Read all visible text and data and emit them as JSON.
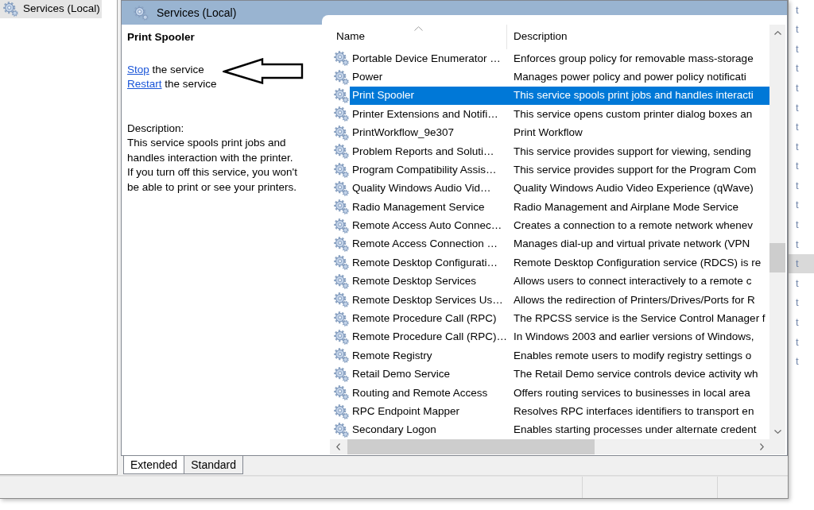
{
  "tree": {
    "items": [
      {
        "label": "Services (Local)",
        "selected": true
      }
    ]
  },
  "header": {
    "title": "Services (Local)"
  },
  "details": {
    "title": "Print Spooler",
    "actions": [
      {
        "link": "Stop",
        "text": "the service"
      },
      {
        "link": "Restart",
        "text": "the service"
      }
    ],
    "description_label": "Description:",
    "description_lines": [
      "This service spools print jobs and",
      "handles interaction with the printer.",
      "If you turn off this service, you won't",
      "be able to print or see your printers."
    ]
  },
  "table": {
    "columns": [
      {
        "label": "Name",
        "sorted": true
      },
      {
        "label": "Description",
        "sorted": false
      }
    ],
    "rows": [
      {
        "name": "Portable Device Enumerator …",
        "description": "Enforces group policy for removable mass-storage",
        "selected": false
      },
      {
        "name": "Power",
        "description": "Manages power policy and power policy notificati",
        "selected": false
      },
      {
        "name": "Print Spooler",
        "description": "This service spools print jobs and handles interacti",
        "selected": true
      },
      {
        "name": "Printer Extensions and Notifi…",
        "description": "This service opens custom printer dialog boxes an",
        "selected": false
      },
      {
        "name": "PrintWorkflow_9e307",
        "description": "Print Workflow",
        "selected": false
      },
      {
        "name": "Problem Reports and Soluti…",
        "description": "This service provides support for viewing, sending",
        "selected": false
      },
      {
        "name": "Program Compatibility Assis…",
        "description": "This service provides support for the Program Com",
        "selected": false
      },
      {
        "name": "Quality Windows Audio Vid…",
        "description": "Quality Windows Audio Video Experience (qWave)",
        "selected": false
      },
      {
        "name": "Radio Management Service",
        "description": "Radio Management and Airplane Mode Service",
        "selected": false
      },
      {
        "name": "Remote Access Auto Connec…",
        "description": "Creates a connection to a remote network whenev",
        "selected": false
      },
      {
        "name": "Remote Access Connection …",
        "description": "Manages dial-up and virtual private network (VPN",
        "selected": false
      },
      {
        "name": "Remote Desktop Configurati…",
        "description": "Remote Desktop Configuration service (RDCS) is re",
        "selected": false
      },
      {
        "name": "Remote Desktop Services",
        "description": "Allows users to connect interactively to a remote c",
        "selected": false
      },
      {
        "name": "Remote Desktop Services Us…",
        "description": "Allows the redirection of Printers/Drives/Ports for R",
        "selected": false
      },
      {
        "name": "Remote Procedure Call (RPC)",
        "description": "The RPCSS service is the Service Control Manager f",
        "selected": false
      },
      {
        "name": "Remote Procedure Call (RPC)…",
        "description": "In Windows 2003 and earlier versions of Windows,",
        "selected": false
      },
      {
        "name": "Remote Registry",
        "description": "Enables remote users to modify registry settings o",
        "selected": false
      },
      {
        "name": "Retail Demo Service",
        "description": "The Retail Demo service controls device activity wh",
        "selected": false
      },
      {
        "name": "Routing and Remote Access",
        "description": "Offers routing services to businesses in local area",
        "selected": false
      },
      {
        "name": "RPC Endpoint Mapper",
        "description": "Resolves RPC interfaces identifiers to transport en",
        "selected": false
      },
      {
        "name": "Secondary Logon",
        "description": "Enables starting processes under alternate credent",
        "selected": false
      }
    ]
  },
  "tabs": [
    {
      "label": "Extended",
      "selected": true
    },
    {
      "label": "Standard",
      "selected": false
    }
  ],
  "background_window": {
    "rows": [
      {
        "text": "t",
        "selected": false
      },
      {
        "text": "t",
        "selected": false
      },
      {
        "text": "t",
        "selected": false
      },
      {
        "text": "t",
        "selected": false
      },
      {
        "text": "t",
        "selected": false
      },
      {
        "text": "t",
        "selected": false
      },
      {
        "text": "t",
        "selected": false
      },
      {
        "text": "t",
        "selected": false
      },
      {
        "text": "t",
        "selected": false
      },
      {
        "text": "t",
        "selected": false
      },
      {
        "text": "t",
        "selected": false
      },
      {
        "text": "t",
        "selected": false
      },
      {
        "text": "t",
        "selected": false
      },
      {
        "text": "t",
        "selected": true
      },
      {
        "text": "t",
        "selected": false
      },
      {
        "text": "t",
        "selected": false
      },
      {
        "text": "t",
        "selected": false
      },
      {
        "text": "t",
        "selected": false
      },
      {
        "text": "t",
        "selected": false
      }
    ]
  }
}
